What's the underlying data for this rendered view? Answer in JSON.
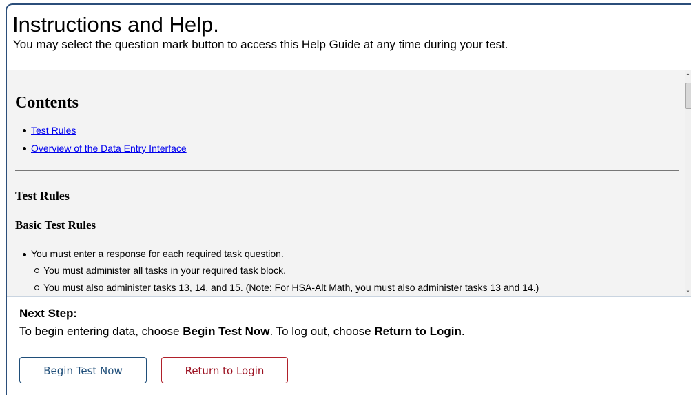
{
  "header": {
    "title": "Instructions and Help.",
    "subtitle": "You may select the question mark button to access this Help Guide at any time during your test."
  },
  "help": {
    "contents_heading": "Contents",
    "toc": [
      {
        "label": "Test Rules"
      },
      {
        "label": "Overview of the Data Entry Interface"
      }
    ],
    "section_heading": "Test Rules",
    "subsection_heading": "Basic Test Rules",
    "rules": {
      "item1": "You must enter a response for each required task question.",
      "sub1": "You must administer all tasks in your required task block.",
      "sub2": "You must also administer tasks 13, 14, and 15. (Note: For HSA-Alt Math, you must also administer tasks 13 and 14.)"
    }
  },
  "next_step": {
    "heading": "Next Step:",
    "text_part1": "To begin entering data, choose ",
    "text_bold1": "Begin Test Now",
    "text_part2": ". To log out, choose ",
    "text_bold2": "Return to Login",
    "text_part3": "."
  },
  "buttons": {
    "begin": "Begin Test Now",
    "return": "Return to Login"
  },
  "colors": {
    "panel_border": "#2b4e7a",
    "link": "#0000ee",
    "begin_button": "#1f4e79",
    "return_button": "#9b1020",
    "content_background": "#f3f3f3"
  }
}
